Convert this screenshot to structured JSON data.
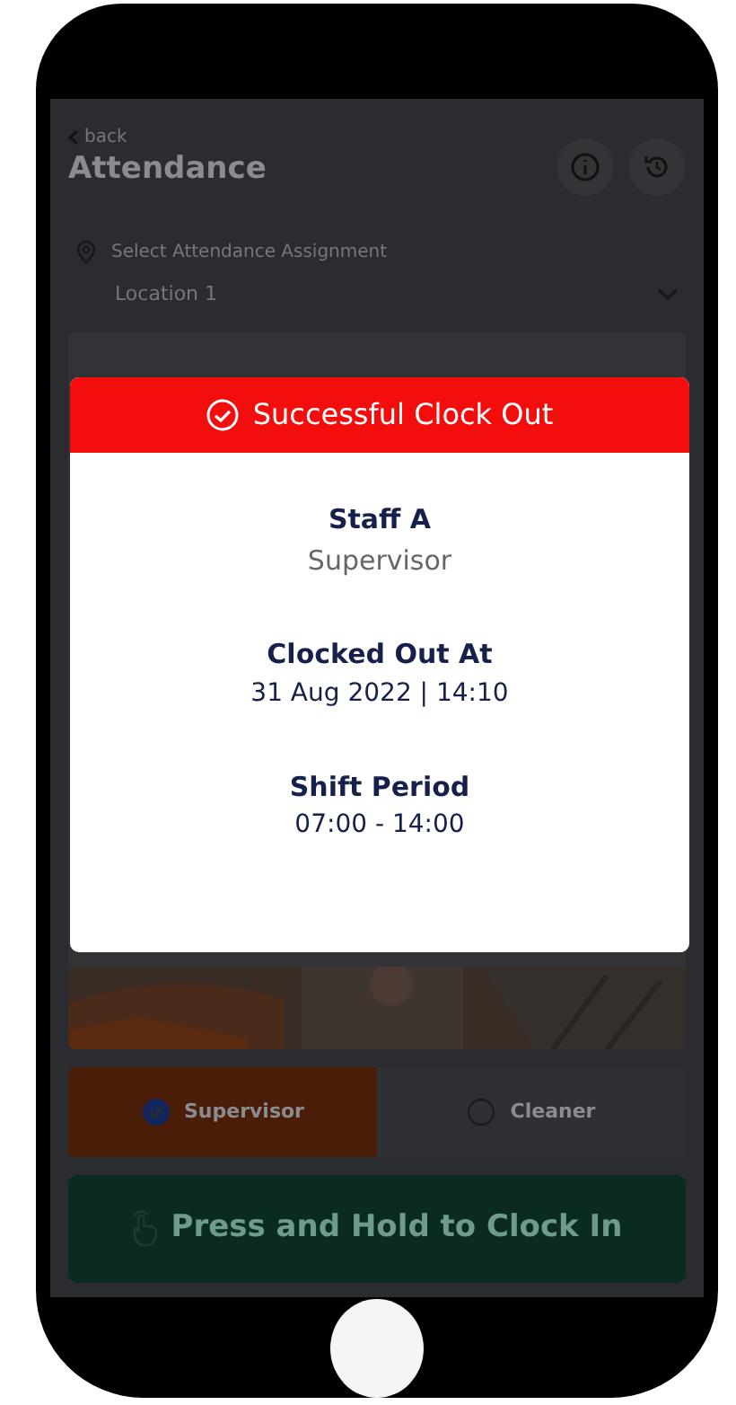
{
  "header": {
    "back": "back",
    "title": "Attendance"
  },
  "assignment": {
    "label": "Select Attendance Assignment",
    "value": "Location 1"
  },
  "roles": [
    {
      "label": "Supervisor",
      "selected": true
    },
    {
      "label": "Cleaner",
      "selected": false
    }
  ],
  "clock_button": "Press and Hold to Clock In",
  "dialog": {
    "title": "Successful Clock Out",
    "name": "Staff A",
    "role": "Supervisor",
    "sections": [
      {
        "heading": "Clocked Out At",
        "value": "31 Aug 2022 | 14:10"
      },
      {
        "heading": "Shift Period",
        "value": "07:00 - 14:00"
      }
    ]
  }
}
